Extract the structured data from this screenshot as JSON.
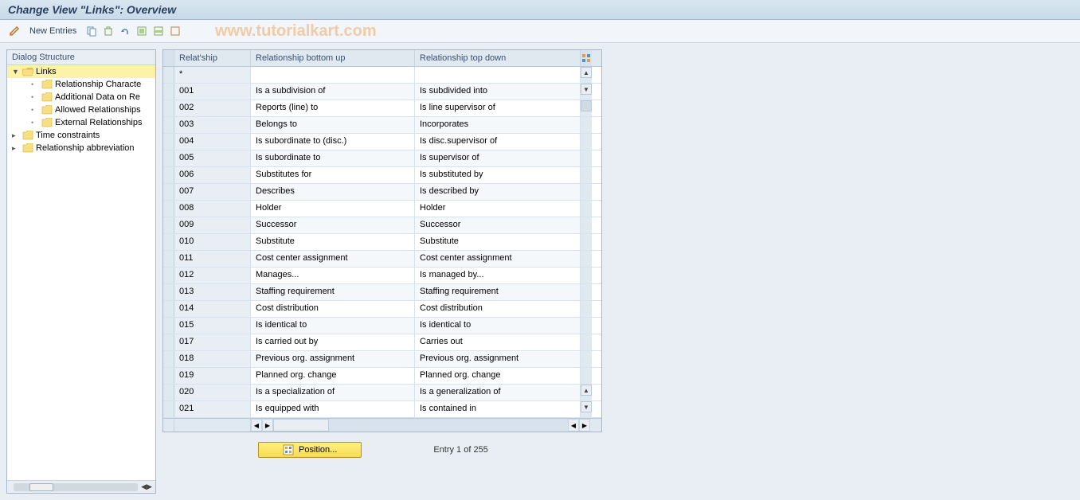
{
  "title": "Change View \"Links\": Overview",
  "watermark": "www.tutorialkart.com",
  "toolbar": {
    "new_entries_label": "New Entries"
  },
  "tree": {
    "header": "Dialog Structure",
    "items": [
      {
        "label": "Links",
        "level": 0,
        "expanded": true,
        "selected": true,
        "folder_open": true
      },
      {
        "label": "Relationship Characte",
        "level": 1,
        "expanded": false,
        "selected": false,
        "folder_open": false
      },
      {
        "label": "Additional Data on Re",
        "level": 1,
        "expanded": false,
        "selected": false,
        "folder_open": false
      },
      {
        "label": "Allowed Relationships",
        "level": 1,
        "expanded": false,
        "selected": false,
        "folder_open": false
      },
      {
        "label": "External Relationships",
        "level": 1,
        "expanded": false,
        "selected": false,
        "folder_open": false
      },
      {
        "label": "Time constraints",
        "level": 0,
        "expanded": false,
        "selected": false,
        "folder_open": false
      },
      {
        "label": "Relationship abbreviation",
        "level": 0,
        "expanded": false,
        "selected": false,
        "folder_open": false
      }
    ]
  },
  "table": {
    "headers": {
      "relship": "Relat'ship",
      "bottom_up": "Relationship bottom up",
      "top_down": "Relationship top down"
    },
    "filter_placeholder": "*",
    "rows": [
      {
        "code": "001",
        "bottom": "Is a subdivision of",
        "top": "Is subdivided into"
      },
      {
        "code": "002",
        "bottom": "Reports (line) to",
        "top": "Is line supervisor of"
      },
      {
        "code": "003",
        "bottom": "Belongs to",
        "top": "Incorporates"
      },
      {
        "code": "004",
        "bottom": "Is subordinate to (disc.)",
        "top": "Is disc.supervisor of"
      },
      {
        "code": "005",
        "bottom": "Is subordinate to",
        "top": "Is supervisor of"
      },
      {
        "code": "006",
        "bottom": "Substitutes for",
        "top": "Is substituted by"
      },
      {
        "code": "007",
        "bottom": "Describes",
        "top": "Is described by"
      },
      {
        "code": "008",
        "bottom": "Holder",
        "top": "Holder"
      },
      {
        "code": "009",
        "bottom": "Successor",
        "top": "Successor"
      },
      {
        "code": "010",
        "bottom": "Substitute",
        "top": "Substitute"
      },
      {
        "code": "011",
        "bottom": "Cost center assignment",
        "top": "Cost center assignment"
      },
      {
        "code": "012",
        "bottom": "Manages...",
        "top": "Is managed by..."
      },
      {
        "code": "013",
        "bottom": "Staffing requirement",
        "top": "Staffing requirement"
      },
      {
        "code": "014",
        "bottom": "Cost distribution",
        "top": "Cost distribution"
      },
      {
        "code": "015",
        "bottom": "Is identical to",
        "top": "Is identical to"
      },
      {
        "code": "017",
        "bottom": "Is carried out by",
        "top": "Carries out"
      },
      {
        "code": "018",
        "bottom": "Previous org. assignment",
        "top": "Previous org. assignment"
      },
      {
        "code": "019",
        "bottom": "Planned org. change",
        "top": "Planned org. change"
      },
      {
        "code": "020",
        "bottom": "Is a specialization of",
        "top": "Is a generalization of"
      },
      {
        "code": "021",
        "bottom": "Is equipped with",
        "top": "Is contained in"
      }
    ]
  },
  "position_button_label": "Position...",
  "entry_counter": "Entry 1 of 255"
}
